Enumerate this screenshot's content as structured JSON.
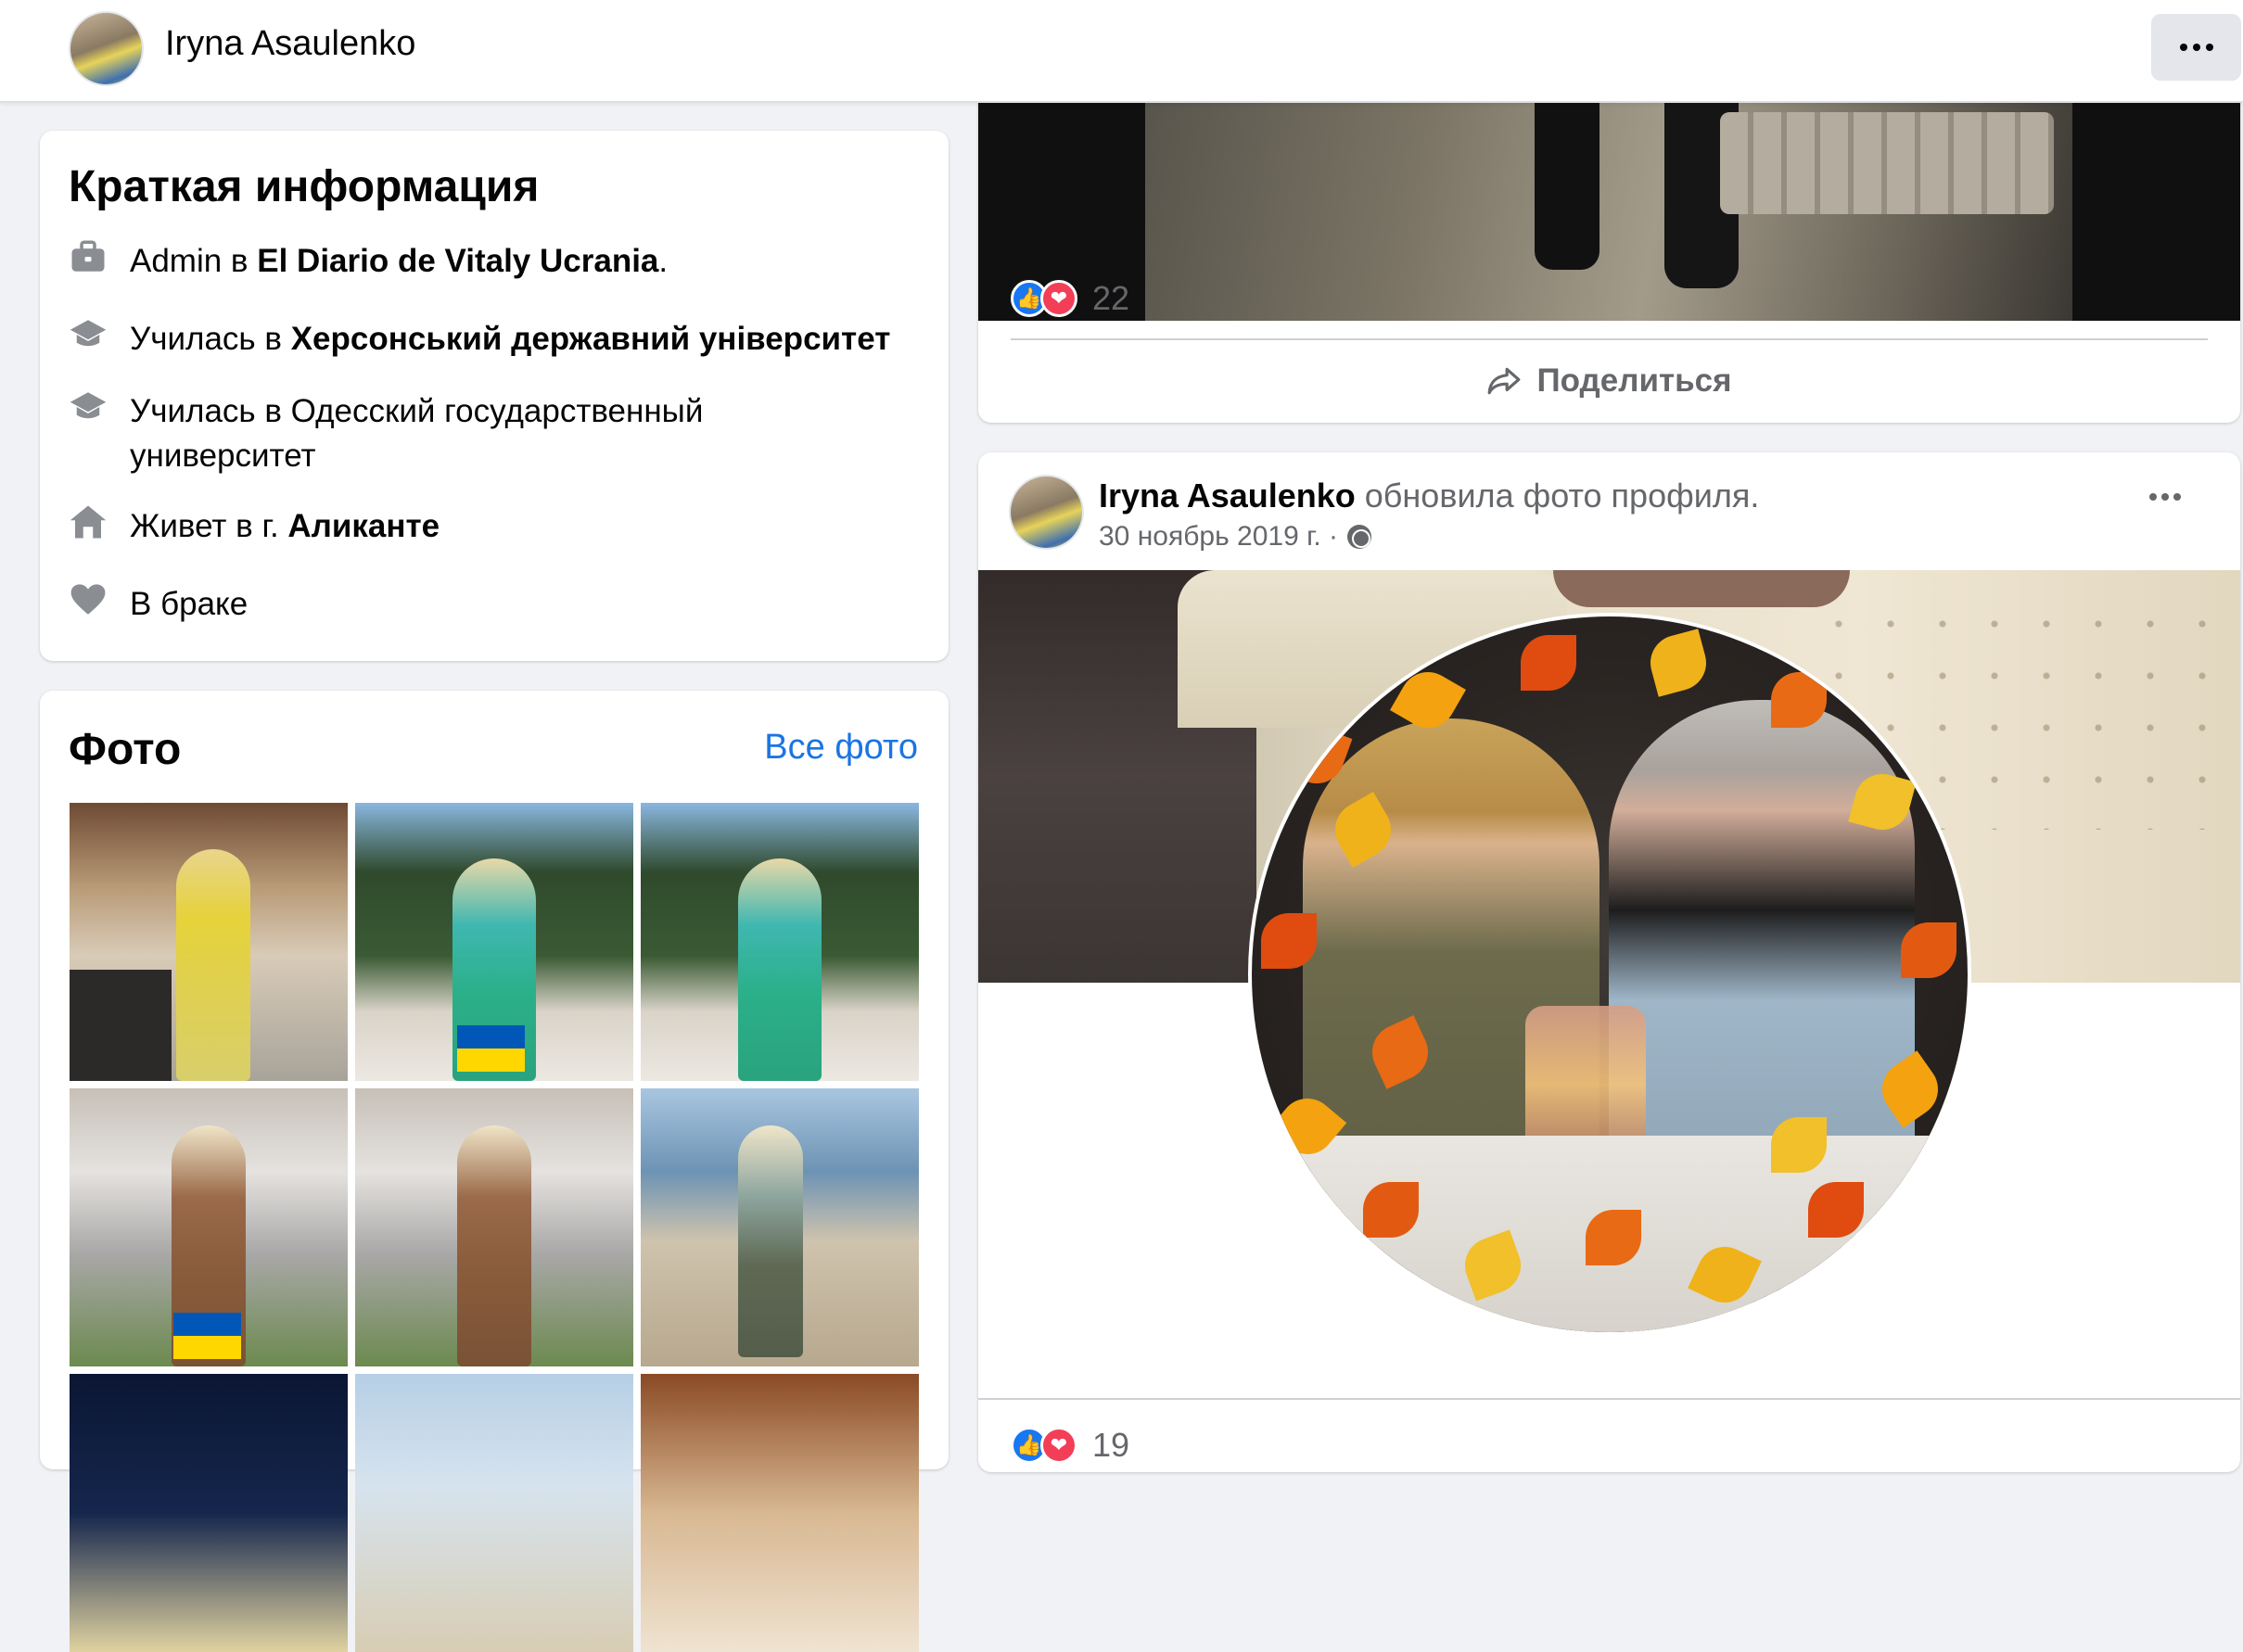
{
  "topbar": {
    "profile_name": "Iryna Asaulenko",
    "more_icon": "ellipsis-icon"
  },
  "intro": {
    "title": "Краткая информация",
    "items": [
      {
        "icon": "briefcase-icon",
        "prefix": "Admin в ",
        "bold": "El Diario de Vitaly Ucrania",
        "suffix": "."
      },
      {
        "icon": "graduation-cap-icon",
        "prefix": "Училась в ",
        "bold": "Херсонський державний університет",
        "suffix": ""
      },
      {
        "icon": "graduation-cap-icon",
        "prefix": "Училась в Одесский государственный",
        "line2": "университет",
        "bold": "",
        "suffix": ""
      },
      {
        "icon": "home-icon",
        "prefix": "Живет в г. ",
        "bold": "Аликанте",
        "suffix": ""
      },
      {
        "icon": "heart-icon",
        "prefix": "В браке",
        "bold": "",
        "suffix": ""
      }
    ]
  },
  "photos": {
    "title": "Фото",
    "all_link": "Все фото"
  },
  "post1": {
    "reaction_count": "22",
    "share_label": "Поделиться"
  },
  "post2": {
    "author": "Iryna Asaulenko",
    "action": " обновила фото профиля.",
    "date": "30 ноябрь 2019 г. ·",
    "reaction_count": "19"
  },
  "colors": {
    "accent": "#1b74e4",
    "like": "#1877f2",
    "love": "#f33e58",
    "secondary_text": "#65676b",
    "background": "#f0f2f5"
  }
}
